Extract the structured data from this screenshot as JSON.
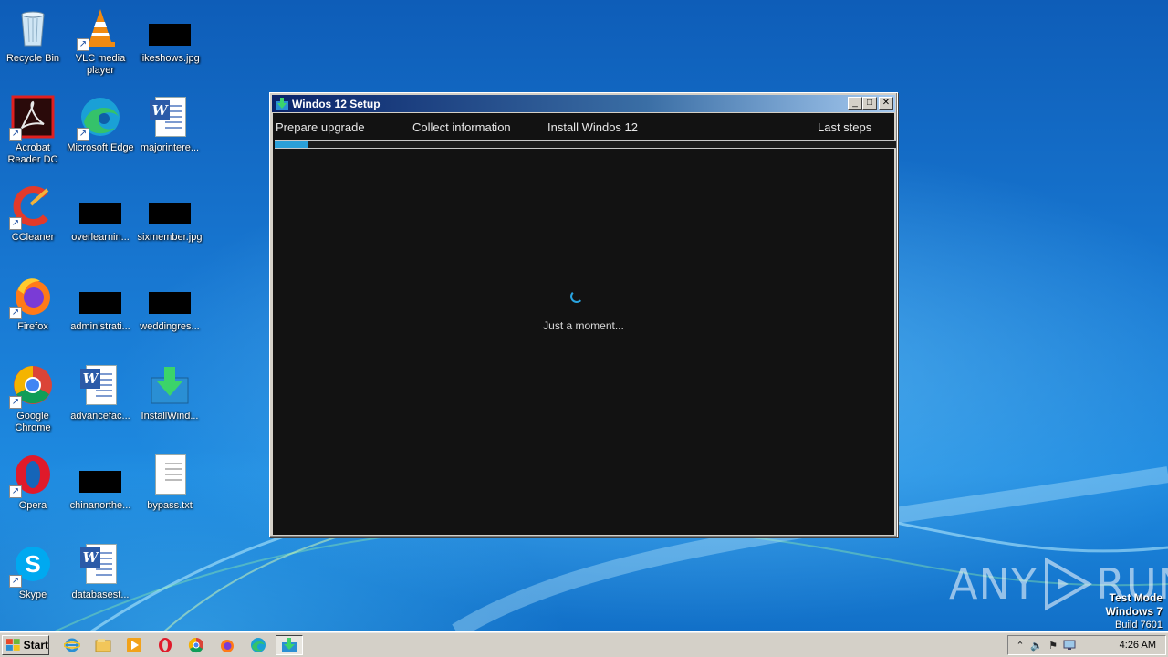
{
  "desktop": {
    "icons": [
      {
        "label": "Recycle Bin"
      },
      {
        "label": "VLC media player"
      },
      {
        "label": "likeshows.jpg"
      },
      {
        "label": "Acrobat Reader DC"
      },
      {
        "label": "Microsoft Edge"
      },
      {
        "label": "majorintere..."
      },
      {
        "label": "CCleaner"
      },
      {
        "label": "overlearnin..."
      },
      {
        "label": "sixmember.jpg"
      },
      {
        "label": "Firefox"
      },
      {
        "label": "administrati..."
      },
      {
        "label": "weddingres..."
      },
      {
        "label": "Google Chrome"
      },
      {
        "label": "advancefac..."
      },
      {
        "label": "InstallWind..."
      },
      {
        "label": "Opera"
      },
      {
        "label": "chinanorthe..."
      },
      {
        "label": "bypass.txt"
      },
      {
        "label": "Skype"
      },
      {
        "label": "databasest..."
      }
    ]
  },
  "setup_window": {
    "title": "Windos 12 Setup",
    "steps": [
      "Prepare upgrade",
      "Collect information",
      "Install Windos 12",
      "Last steps"
    ],
    "progress_fraction": 0.055,
    "status_text": "Just a moment...",
    "accent_color": "#2a9fd8"
  },
  "watermark": {
    "left": "ANY",
    "right": "RUN"
  },
  "test_mode": {
    "line1": "Test Mode",
    "line2": "Windows 7",
    "line3": "Build 7601"
  },
  "taskbar": {
    "start_label": "Start",
    "pinned": [
      "internet-explorer",
      "file-explorer",
      "media-player",
      "opera",
      "chrome",
      "firefox",
      "edge",
      "setup"
    ],
    "clock": "4:26 AM"
  }
}
